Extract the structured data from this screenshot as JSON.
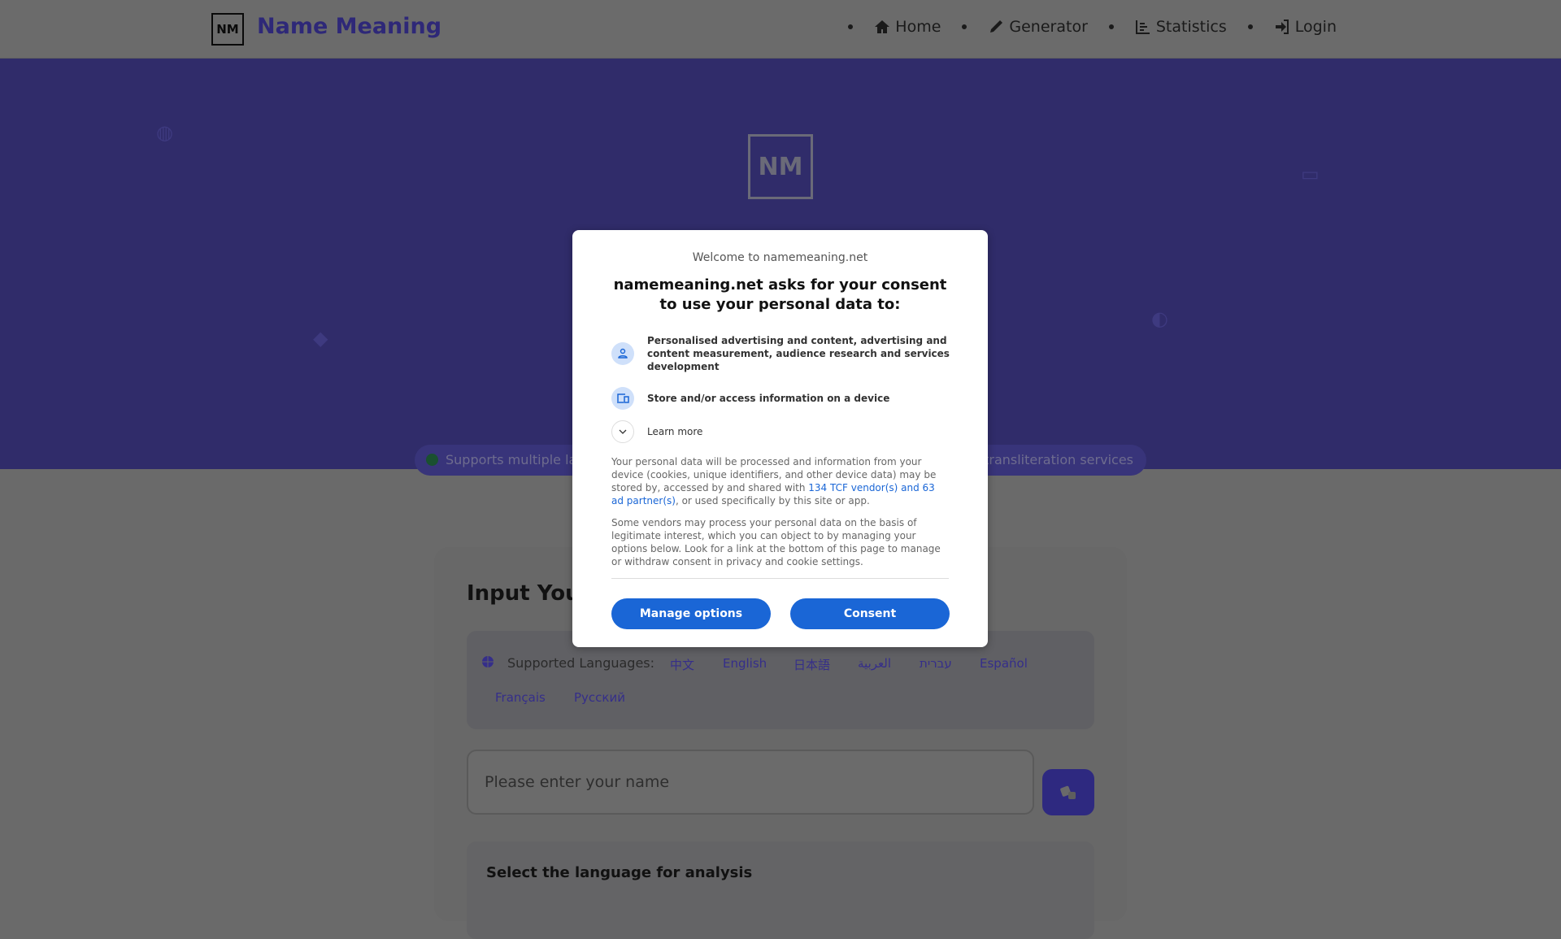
{
  "header": {
    "logo_text": "NM",
    "brand": "Name Meaning",
    "nav": [
      {
        "label": "Home",
        "icon": "home-icon"
      },
      {
        "label": "Generator",
        "icon": "pencil-icon"
      },
      {
        "label": "Statistics",
        "icon": "chart-icon"
      },
      {
        "label": "Login",
        "icon": "login-icon"
      }
    ]
  },
  "hero": {
    "logo_text": "NM",
    "pill_left": "Supports multiple lan",
    "pill_right": "al transliteration services"
  },
  "card": {
    "title": "Input Your",
    "languages_label": "Supported Languages:",
    "languages": [
      "中文",
      "English",
      "日本語",
      "العربية",
      "עברית",
      "Español",
      "Français",
      "Русский"
    ],
    "name_placeholder": "Please enter your name",
    "select_title": "Select the language for analysis"
  },
  "consent": {
    "welcome": "Welcome to namemeaning.net",
    "title": "namemeaning.net asks for your consent to use your personal data to:",
    "purposes": [
      "Personalised advertising and content, advertising and content measurement, audience research and services development",
      "Store and/or access information on a device"
    ],
    "learn_more": "Learn more",
    "body1_a": "Your personal data will be processed and information from your device (cookies, unique identifiers, and other device data) may be stored by, accessed by and shared with ",
    "body1_link": "134 TCF vendor(s) and 63 ad partner(s)",
    "body1_b": ", or used specifically by this site or app.",
    "body2": "Some vendors may process your personal data on the basis of legitimate interest, which you can object to by managing your options below. Look for a link at the bottom of this page to manage or withdraw consent in privacy and cookie settings.",
    "manage_label": "Manage options",
    "consent_label": "Consent"
  },
  "colors": {
    "brand": "#4f46e5",
    "hero": "#5a55e0",
    "consent_button": "#1a66d6"
  }
}
